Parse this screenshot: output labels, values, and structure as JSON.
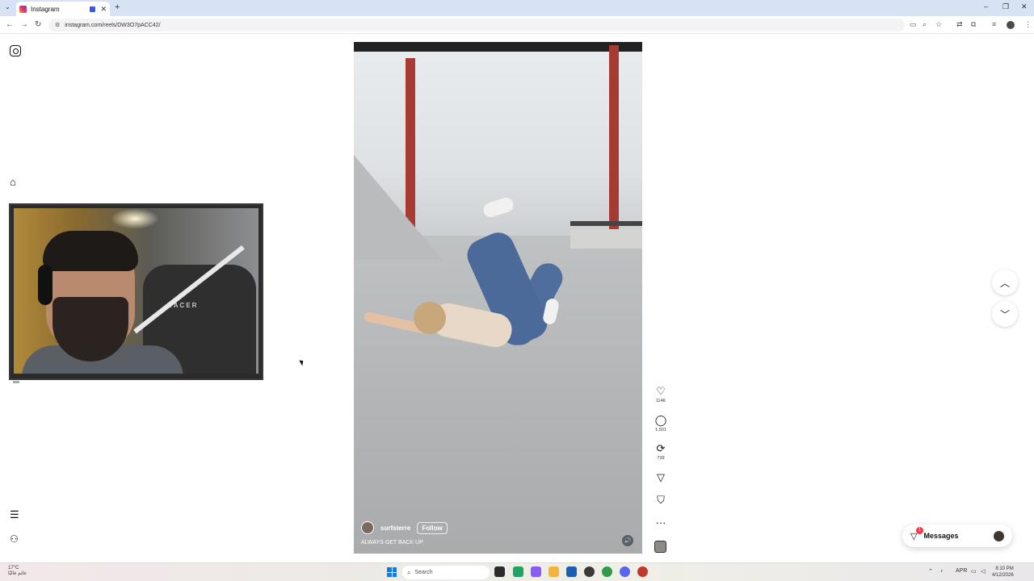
{
  "browser": {
    "tab_title": "Instagram",
    "tab_close": "✕",
    "new_tab": "+",
    "url": "instagram.com/reels/DW3O7pACC42/",
    "nav": {
      "back": "←",
      "forward": "→",
      "reload": "↻"
    },
    "window_controls": {
      "minimize": "–",
      "restore": "❐",
      "close": "✕"
    }
  },
  "sidebar": {
    "home_icon": "home-icon",
    "menu_icon": "menu-icon",
    "more_icon": "apps-icon"
  },
  "webcam": {
    "chair_text": "RACER"
  },
  "reel": {
    "username": "surfsterre",
    "follow_label": "Follow",
    "caption": "ALWAYS GET BACK UP",
    "mute_icon": "🔊"
  },
  "actions": {
    "likes": "114K",
    "comments": "1,501",
    "reposts": "739"
  },
  "messages": {
    "label": "Messages",
    "badge": "1"
  },
  "taskbar": {
    "weather_temp": "17°C",
    "weather_desc": "غائم غالبًا",
    "search_placeholder": "Search",
    "lang": "APR",
    "time": "8:10 PM",
    "date": "4/12/2026"
  },
  "colors": {
    "accent_red": "#ff3040",
    "windows_blue": "#1b7ad8"
  }
}
